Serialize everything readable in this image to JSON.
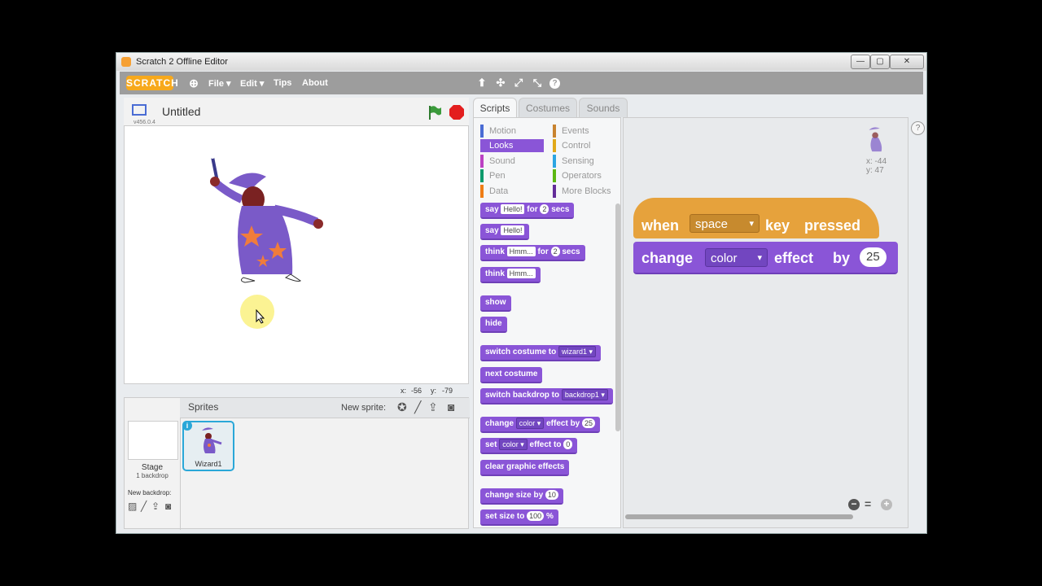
{
  "window": {
    "title": "Scratch 2 Offline Editor",
    "minimize": "—",
    "maximize": "▢",
    "close": "✕"
  },
  "menubar": {
    "logo": "SCRATCH",
    "items": [
      "File ▾",
      "Edit ▾",
      "Tips",
      "About"
    ],
    "tools": [
      "⬆",
      "✣",
      "⤢",
      "⤡",
      "?"
    ]
  },
  "stage": {
    "project_title": "Untitled",
    "version": "v456.0.4",
    "mouse_x_label": "x:",
    "mouse_x": "-56",
    "mouse_y_label": "y:",
    "mouse_y": "-79"
  },
  "sprites": {
    "header": "Sprites",
    "new_sprite": "New sprite:",
    "stage_label": "Stage",
    "stage_sub": "1 backdrop",
    "new_backdrop": "New backdrop:",
    "sprite_name": "Wizard1"
  },
  "tabs": [
    "Scripts",
    "Costumes",
    "Sounds"
  ],
  "categories": [
    {
      "label": "Motion",
      "color": "#4a6cd4"
    },
    {
      "label": "Events",
      "color": "#c88330"
    },
    {
      "label": "Looks",
      "color": "#8a55d7"
    },
    {
      "label": "Control",
      "color": "#e1a91a"
    },
    {
      "label": "Sound",
      "color": "#bb42c3"
    },
    {
      "label": "Sensing",
      "color": "#2ca5e2"
    },
    {
      "label": "Pen",
      "color": "#0e9a6c"
    },
    {
      "label": "Operators",
      "color": "#5cb712"
    },
    {
      "label": "Data",
      "color": "#ee7d16"
    },
    {
      "label": "More Blocks",
      "color": "#632d99"
    }
  ],
  "palette_blocks": {
    "say_for": {
      "a": "say",
      "b": "Hello!",
      "c": "for",
      "d": "2",
      "e": "secs"
    },
    "say": {
      "a": "say",
      "b": "Hello!"
    },
    "think_for": {
      "a": "think",
      "b": "Hmm...",
      "c": "for",
      "d": "2",
      "e": "secs"
    },
    "think": {
      "a": "think",
      "b": "Hmm..."
    },
    "show": "show",
    "hide": "hide",
    "switch_costume": {
      "a": "switch costume to",
      "b": "wizard1 ▾"
    },
    "next_costume": "next costume",
    "switch_backdrop": {
      "a": "switch backdrop to",
      "b": "backdrop1 ▾"
    },
    "change_effect": {
      "a": "change",
      "b": "color ▾",
      "c": "effect by",
      "d": "25"
    },
    "set_effect": {
      "a": "set",
      "b": "color ▾",
      "c": "effect to",
      "d": "0"
    },
    "clear_effects": "clear graphic effects",
    "change_size": {
      "a": "change size by",
      "b": "10"
    },
    "set_size": {
      "a": "set size to",
      "b": "100",
      "c": "%"
    }
  },
  "script": {
    "hat": {
      "when": "when",
      "key": "space",
      "key_dd": "▾",
      "rest1": "key",
      "rest2": "pressed"
    },
    "change": {
      "change": "change",
      "effect_dd": "color",
      "dd": "▾",
      "effect": "effect",
      "by": "by",
      "value": "25"
    }
  },
  "scripts_area": {
    "sprite_x": "x: -44",
    "sprite_y": "y: 47",
    "help": "?"
  },
  "zoom": [
    "−",
    "=",
    "+"
  ]
}
